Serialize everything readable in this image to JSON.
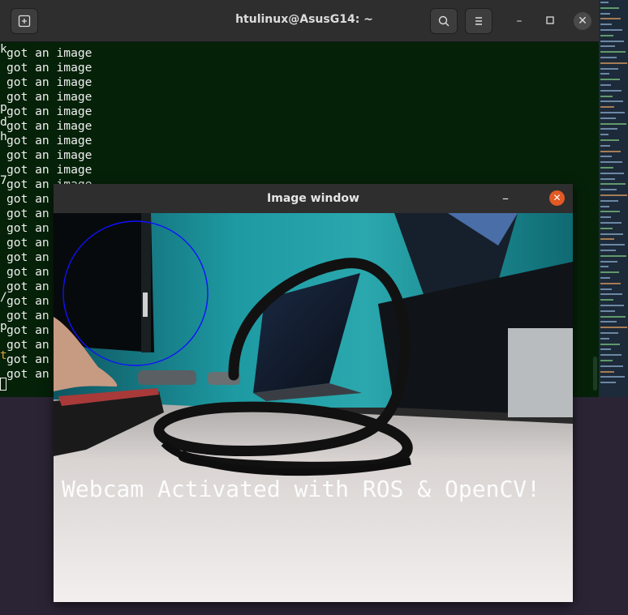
{
  "terminal": {
    "title": "htulinux@AsusG14: ~",
    "lines": [
      {
        "prefix": "k",
        "text": "got an image"
      },
      {
        "prefix": " ",
        "text": "got an image"
      },
      {
        "prefix": " ",
        "text": "got an image"
      },
      {
        "prefix": " ",
        "text": "got an image"
      },
      {
        "prefix": "p",
        "text": "got an image"
      },
      {
        "prefix": "d",
        "text": "got an image"
      },
      {
        "prefix": "h",
        "text": "got an image"
      },
      {
        "prefix": " ",
        "text": "got an image"
      },
      {
        "prefix": " ",
        "text": "got an image"
      },
      {
        "prefix": "7",
        "text": "got an image"
      },
      {
        "prefix": " ",
        "text": "got an"
      },
      {
        "prefix": " ",
        "text": "got an"
      },
      {
        "prefix": " ",
        "text": "got an"
      },
      {
        "prefix": " ",
        "text": "got an"
      },
      {
        "prefix": " ",
        "text": "got an"
      },
      {
        "prefix": " ",
        "text": "got an"
      },
      {
        "prefix": " ",
        "text": "got an"
      },
      {
        "prefix": "/",
        "text": "got an"
      },
      {
        "prefix": " ",
        "text": "got an"
      },
      {
        "prefix": "p",
        "text": "got an"
      },
      {
        "prefix": " ",
        "text": "got an"
      },
      {
        "prefix": "t",
        "text": "got an"
      },
      {
        "prefix": " ",
        "text": "got an"
      }
    ]
  },
  "image_window": {
    "title": "Image window",
    "overlay_text": "Webcam Activated with ROS & OpenCV!",
    "circle_color": "#1010ff"
  }
}
